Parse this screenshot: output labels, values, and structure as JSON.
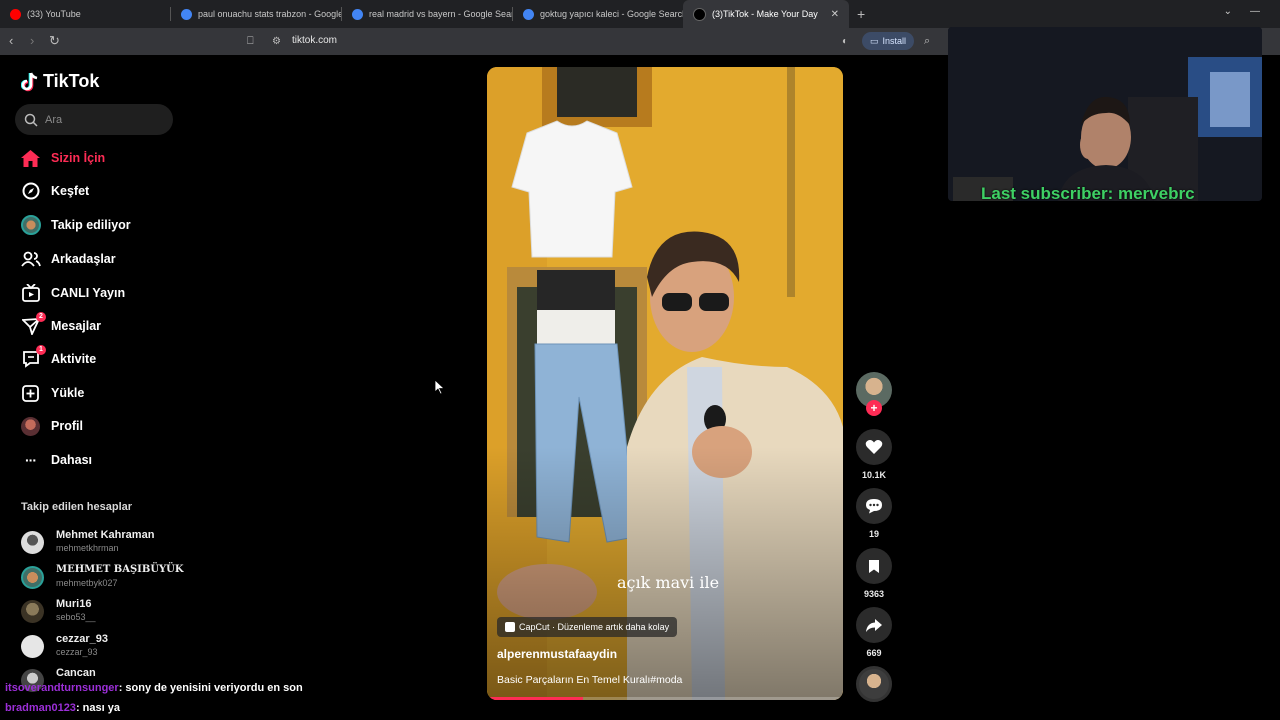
{
  "browser": {
    "tabs": [
      {
        "label": "(33) YouTube",
        "fav_color": "#ff0000",
        "active": false
      },
      {
        "label": "paul onuachu stats trabzon - Google Sear",
        "fav_color": "#4285f4",
        "active": false
      },
      {
        "label": "real madrid vs bayern - Google Search",
        "fav_color": "#4285f4",
        "active": false
      },
      {
        "label": "goktug yapıcı kaleci - Google Search",
        "fav_color": "#4285f4",
        "active": false
      },
      {
        "label": "(3)TikTok - Make Your Day",
        "fav_color": "#000000",
        "active": true
      }
    ],
    "url": "tiktok.com",
    "install_label": "Install"
  },
  "sidebar": {
    "logo": "TikTok",
    "search_placeholder": "Ara",
    "nav": [
      {
        "label": "Sizin İçin",
        "icon": "home-icon",
        "active": true
      },
      {
        "label": "Keşfet",
        "icon": "compass-icon"
      },
      {
        "label": "Takip ediliyor",
        "icon": "following-avatar-icon"
      },
      {
        "label": "Arkadaşlar",
        "icon": "friends-icon"
      },
      {
        "label": "CANLI Yayın",
        "icon": "live-icon"
      },
      {
        "label": "Mesajlar",
        "icon": "messages-icon",
        "badge": "2"
      },
      {
        "label": "Aktivite",
        "icon": "activity-icon",
        "badge": "1"
      },
      {
        "label": "Yükle",
        "icon": "upload-icon"
      },
      {
        "label": "Profil",
        "icon": "profile-avatar-icon"
      },
      {
        "label": "Dahası",
        "icon": "more-icon"
      }
    ],
    "following_title": "Takip edilen hesaplar",
    "following": [
      {
        "name": "Mehmet Kahraman",
        "username": "mehmetkhrman"
      },
      {
        "name": "MEHMET BAŞIBÜYÜK",
        "username": "mehmetbyk027"
      },
      {
        "name": "Muri16",
        "username": "sebo53__"
      },
      {
        "name": "cezzar_93",
        "username": "cezzar_93"
      },
      {
        "name": "Cancan",
        "username": ""
      }
    ]
  },
  "chat_overlay": [
    {
      "user": "itsoverandturnsunger",
      "message": ": sony de yenisini veriyordu en son"
    },
    {
      "user": "bradman0123",
      "message": ": nası ya"
    }
  ],
  "video": {
    "caption_overlay": "açık mavi ile",
    "capcut_label": "CapCut · Düzenleme artık daha kolay",
    "author": "alperenmustafaaydin",
    "description": "Basic Parçaların En Temel Kuralı#moda",
    "progress": 0.27
  },
  "actions": {
    "likes": "10.1K",
    "comments": "19",
    "saves": "9363",
    "shares": "669"
  },
  "webcam": {
    "overlay_text": "Last subscriber: mervebrc"
  }
}
